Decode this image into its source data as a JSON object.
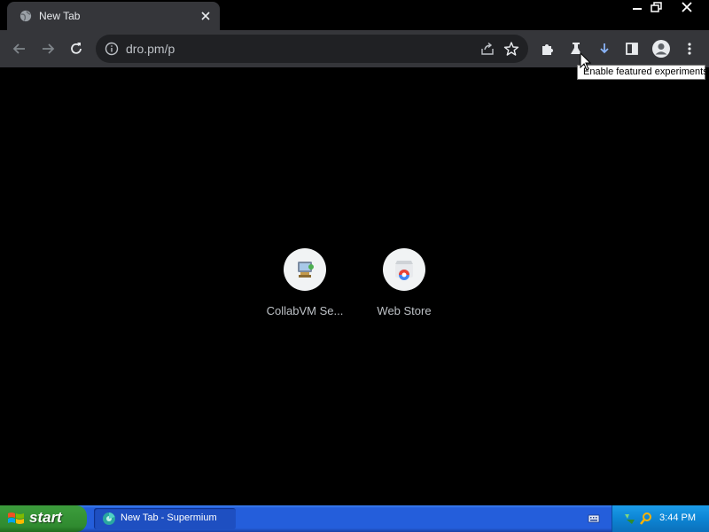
{
  "window": {
    "tab": {
      "title": "New Tab"
    },
    "controls": [
      "minimize-icon",
      "restore-icon",
      "close-icon"
    ]
  },
  "toolbar": {
    "url": "dro.pm/p",
    "buttons": [
      "back-icon",
      "forward-icon",
      "reload-icon",
      "extensions-icon",
      "labs-flask-icon",
      "download-icon",
      "side-panel-icon",
      "profile-icon",
      "menu-icon"
    ],
    "tooltip": "Enable featured experiments"
  },
  "shortcuts": [
    {
      "label": "CollabVM Se...",
      "icon": "collabvm-icon"
    },
    {
      "label": "Web Store",
      "icon": "web-store-icon"
    }
  ],
  "taskbar": {
    "start_label": "start",
    "task_label": "New Tab - Supermium",
    "clock": "3:44 PM"
  },
  "colors": {
    "tab_bg": "#35363a",
    "page_bg": "#000000",
    "taskbar_blue": "#245edb",
    "start_green": "#3a9a3a",
    "download_blue": "#8ab4f8"
  }
}
